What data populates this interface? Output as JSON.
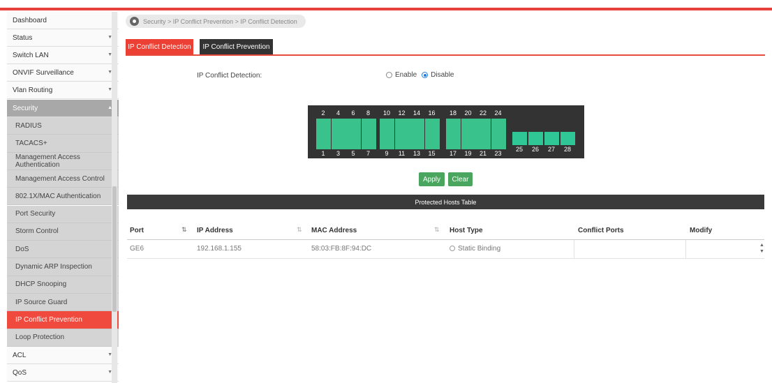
{
  "sidebar": {
    "top_items": [
      {
        "label": "Dashboard",
        "chevron": false
      },
      {
        "label": "Status",
        "chevron": true
      },
      {
        "label": "Switch LAN",
        "chevron": true
      },
      {
        "label": "ONVIF Surveillance",
        "chevron": true
      },
      {
        "label": "Vlan Routing",
        "chevron": true
      }
    ],
    "security": {
      "label": "Security",
      "expanded": true
    },
    "security_items": [
      "RADIUS",
      "TACACS+",
      "Management Access Authentication",
      "Management Access Control",
      "802.1X/MAC Authentication",
      "Port Security",
      "Storm Control",
      "DoS",
      "Dynamic ARP Inspection",
      "DHCP Snooping",
      "IP Source Guard",
      "IP Conflict Prevention",
      "Loop Protection"
    ],
    "active_item": "IP Conflict Prevention",
    "bottom_items": [
      {
        "label": "ACL",
        "chevron": true
      },
      {
        "label": "QoS",
        "chevron": true
      }
    ]
  },
  "breadcrumb": "Security > IP Conflict Prevention > IP Conflict Detection",
  "tabs": [
    {
      "label": "IP Conflict Detection",
      "active": true
    },
    {
      "label": "IP Conflict Prevention",
      "active": false
    }
  ],
  "detection": {
    "label": "IP Conflict Detection:",
    "options": [
      {
        "label": "Enable",
        "selected": false
      },
      {
        "label": "Disable",
        "selected": true
      }
    ]
  },
  "ports": {
    "top_numbers": [
      "2",
      "4",
      "6",
      "8",
      "10",
      "12",
      "14",
      "16",
      "18",
      "20",
      "22",
      "24"
    ],
    "bottom_numbers": [
      "1",
      "3",
      "5",
      "7",
      "9",
      "11",
      "13",
      "15",
      "17",
      "19",
      "21",
      "23"
    ],
    "sfp_numbers": [
      "25",
      "26",
      "27",
      "28"
    ]
  },
  "buttons": {
    "apply": "Apply",
    "clear": "Clear"
  },
  "table": {
    "title": "Protected Hosts Table",
    "columns": [
      "Port",
      "IP Address",
      "MAC Address",
      "Host Type",
      "Conflict Ports",
      "Modify"
    ],
    "rows": [
      {
        "port": "GE6",
        "ip": "192.168.1.155",
        "mac": "58:03:FB:8F:94:DC",
        "host_type": "Static Binding",
        "conflict_ports": "",
        "modify": ""
      }
    ]
  },
  "colors": {
    "accent": "#ed4034",
    "port_green": "#39c28c",
    "button_green": "#4aa55e"
  }
}
